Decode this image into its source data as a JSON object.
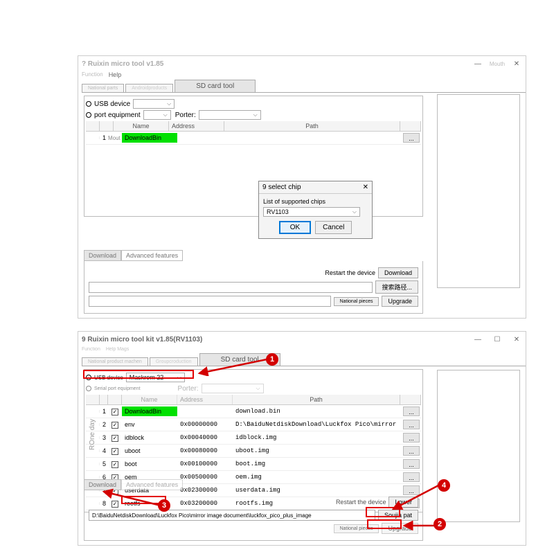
{
  "win1": {
    "title": "? Ruixin micro tool v1.85",
    "minimize": "—",
    "mouth": "Mouth",
    "close": "✕",
    "menu_function": "Function",
    "menu_help": "Help",
    "tab_national": "National parts",
    "tab_android": "Androidproducts",
    "tab_sd": "SD card tool",
    "usb_label": "USB device",
    "port_label": "port equipment",
    "porter_label": "Porter:",
    "col_name": "Name",
    "col_addr": "Address",
    "col_path": "Path",
    "row1_idx": "1",
    "row1_mout": "Mout",
    "row1_name": "DownloadBin",
    "dialog_title": "9 select chip",
    "dialog_close": "✕",
    "dialog_text": "List of supported chips",
    "dialog_val": "RV1103",
    "dialog_ok": "OK",
    "dialog_cancel": "Cancel",
    "btab_download": "Download",
    "btab_adv": "Advanced features",
    "restart": "Restart the device",
    "btn_download": "Download",
    "btn_search": "搜索路径...",
    "btn_national": "National pieces",
    "btn_upgrade": "Upgrade"
  },
  "win2": {
    "title": "9 Ruixin micro tool kit v1.85(RV1103)",
    "minimize": "—",
    "maximize": "☐",
    "close": "✕",
    "menu_function": "Function",
    "menu_help": "Help Mags",
    "tab_national": "National product machen",
    "tab_group": "Groupcroduction",
    "tab_sd": "SD card tool",
    "usb_label": "USB device",
    "usb_val": "Maskrom  22",
    "serial_label": "Serial port equipment",
    "porter_label": "Porter:",
    "col_name": "Name",
    "col_addr": "Address",
    "col_path": "Path",
    "btab_download": "Download",
    "btab_adv": "Advanced features",
    "restart": "Restart the device",
    "btn_lower": "Lower",
    "path_input": "D:\\BaiduNetdiskDownload\\Luckfox Pico\\mirror image document\\luckfox_pico_plus_image",
    "btn_soujia": "Soujia pat",
    "btn_national": "National pieces",
    "btn_upgrade": "Upgrade",
    "vert": "ROne day"
  },
  "rows": [
    {
      "i": "1",
      "chk": true,
      "name": "DownloadBin",
      "green": true,
      "addr": "",
      "path": "download.bin"
    },
    {
      "i": "2",
      "chk": true,
      "name": "env",
      "addr": "0x00000000",
      "path": "D:\\BaiduNetdiskDownload\\Luckfox Pico\\mirror image document\\luckfo"
    },
    {
      "i": "3",
      "chk": true,
      "name": "idblock",
      "addr": "0x00040000",
      "path": "idblock.img"
    },
    {
      "i": "4",
      "chk": true,
      "name": "uboot",
      "addr": "0x00080000",
      "path": "uboot.img"
    },
    {
      "i": "5",
      "chk": true,
      "name": "boot",
      "addr": "0x00100000",
      "path": "boot.img"
    },
    {
      "i": "6",
      "chk": true,
      "name": "oem",
      "addr": "0x00500000",
      "path": "oem.img"
    },
    {
      "i": "7",
      "chk": true,
      "name": "userdata",
      "addr": "0x02300000",
      "path": "userdata.img"
    },
    {
      "i": "8",
      "chk": true,
      "name": "rootfs",
      "addr": "0x03200000",
      "path": "rootfs.img"
    }
  ],
  "badges": {
    "b1": "1",
    "b2": "2",
    "b3": "3",
    "b4": "4"
  }
}
